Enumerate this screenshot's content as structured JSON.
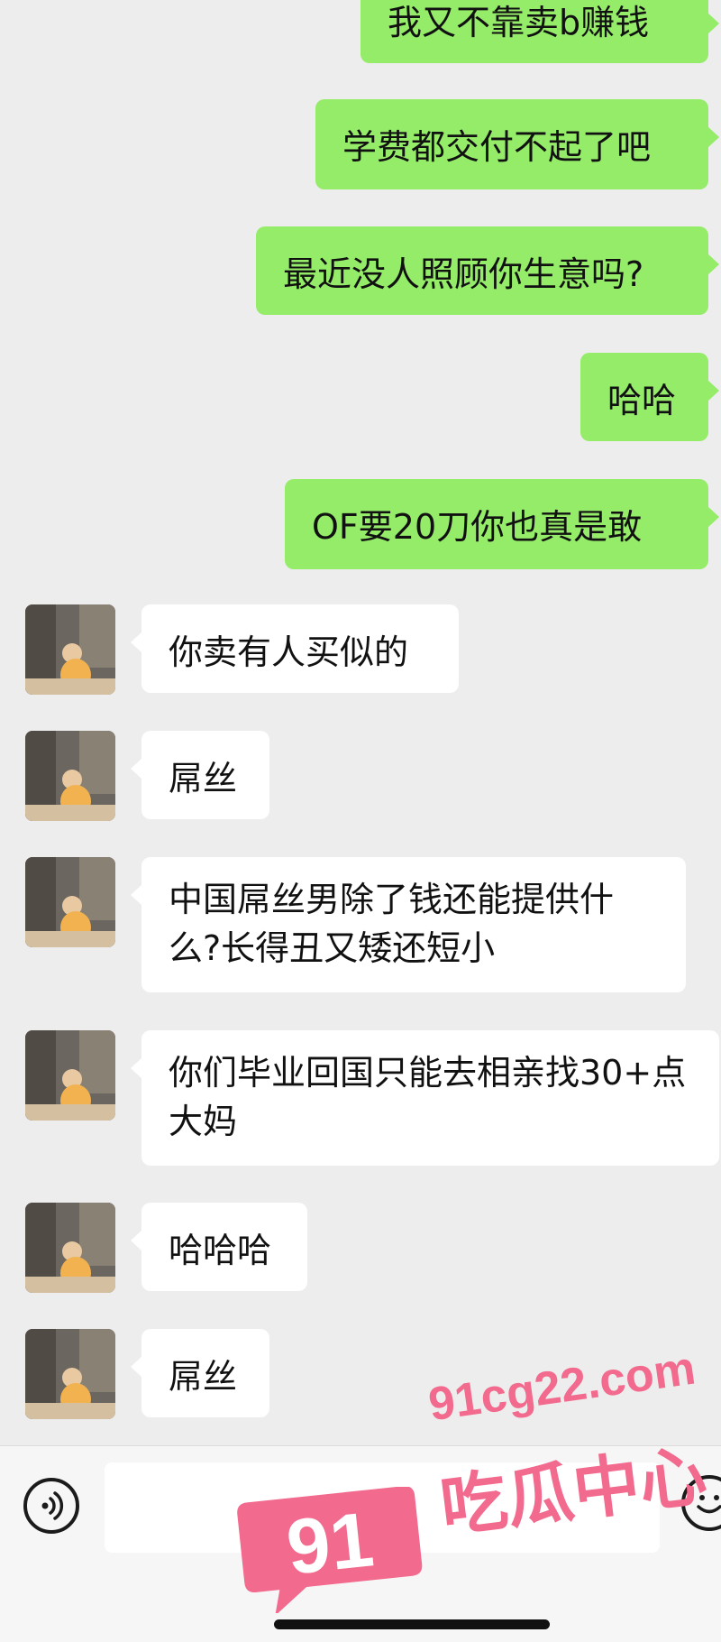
{
  "conversation": {
    "outgoing": [
      {
        "text": "我又不靠卖b赚钱"
      },
      {
        "text": "学费都交付不起了吧"
      },
      {
        "text": "最近没人照顾你生意吗?"
      },
      {
        "text": "哈哈"
      },
      {
        "text": "OF要20刀你也真是敢"
      }
    ],
    "incoming": [
      {
        "text": "你卖有人买似的"
      },
      {
        "text": "屌丝"
      },
      {
        "text": "中国屌丝男除了钱还能提供什么?长得丑又矮还短小"
      },
      {
        "text": "你们毕业回国只能去相亲找30+点大妈"
      },
      {
        "text": "哈哈哈"
      },
      {
        "text": "屌丝"
      }
    ]
  },
  "input_bar": {
    "left_icon": "voice-icon",
    "right_icon": "emoji-icon",
    "message_value": ""
  },
  "watermark": {
    "logo_number": "91",
    "url": "91cg22.com",
    "name": "吃瓜中心"
  },
  "colors": {
    "outgoing_bubble": "#95ec69",
    "incoming_bubble": "#ffffff",
    "background": "#ededed",
    "watermark": "#f26a8d"
  }
}
